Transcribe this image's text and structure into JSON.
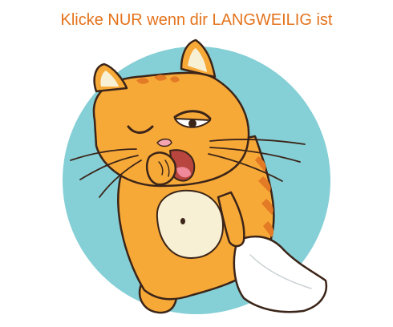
{
  "headline": {
    "text": "Klicke NUR wenn dir LANGWEILIG ist",
    "color": "#e4731c"
  },
  "illustration": {
    "subject": "yawning-cat-icon",
    "backdrop_color": "#85cfd6",
    "fur_color": "#f7a938",
    "stripe_color": "#e37a25",
    "belly_color": "#f8f0d4",
    "pillow_color": "#ffffff",
    "outline_color": "#3b2418"
  }
}
